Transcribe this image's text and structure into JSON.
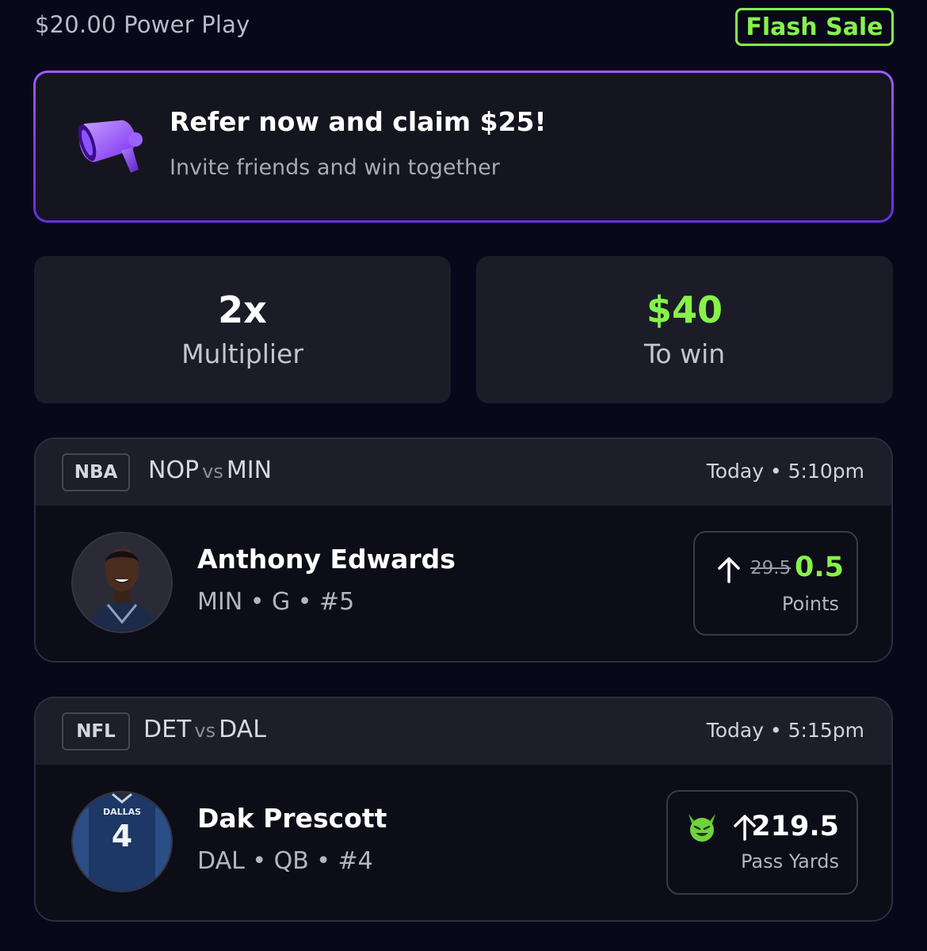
{
  "header": {
    "title": "$20.00 Power Play",
    "badge": "Flash Sale"
  },
  "referral": {
    "icon": "megaphone-icon",
    "title": "Refer now and claim $25!",
    "subtitle": "Invite friends and win together"
  },
  "stats": {
    "multiplier_value": "2x",
    "multiplier_label": "Multiplier",
    "to_win_value": "$40",
    "to_win_label": "To win"
  },
  "picks": [
    {
      "league": "NBA",
      "home": "NOP",
      "vs": "vs",
      "away": "MIN",
      "time": "Today • 5:10pm",
      "player_name": "Anthony Edwards",
      "player_meta": "MIN • G • #5",
      "direction": "up-arrow-icon",
      "old_line": "29.5",
      "line": "0.5",
      "stat_type": "Points"
    },
    {
      "league": "NFL",
      "home": "DET",
      "vs": "vs",
      "away": "DAL",
      "time": "Today • 5:15pm",
      "player_name": "Dak Prescott",
      "player_meta": "DAL • QB • #4",
      "badge_icon": "green-devil-emoji-icon",
      "jersey_text": "DALLAS",
      "jersey_number": "4",
      "direction": "up-arrow-icon",
      "line": "219.5",
      "stat_type": "Pass Yards"
    }
  ],
  "colors": {
    "background": "#08081a",
    "accent_green": "#86f24a",
    "accent_purple": "#8a45ff",
    "card": "#1c1c28"
  }
}
